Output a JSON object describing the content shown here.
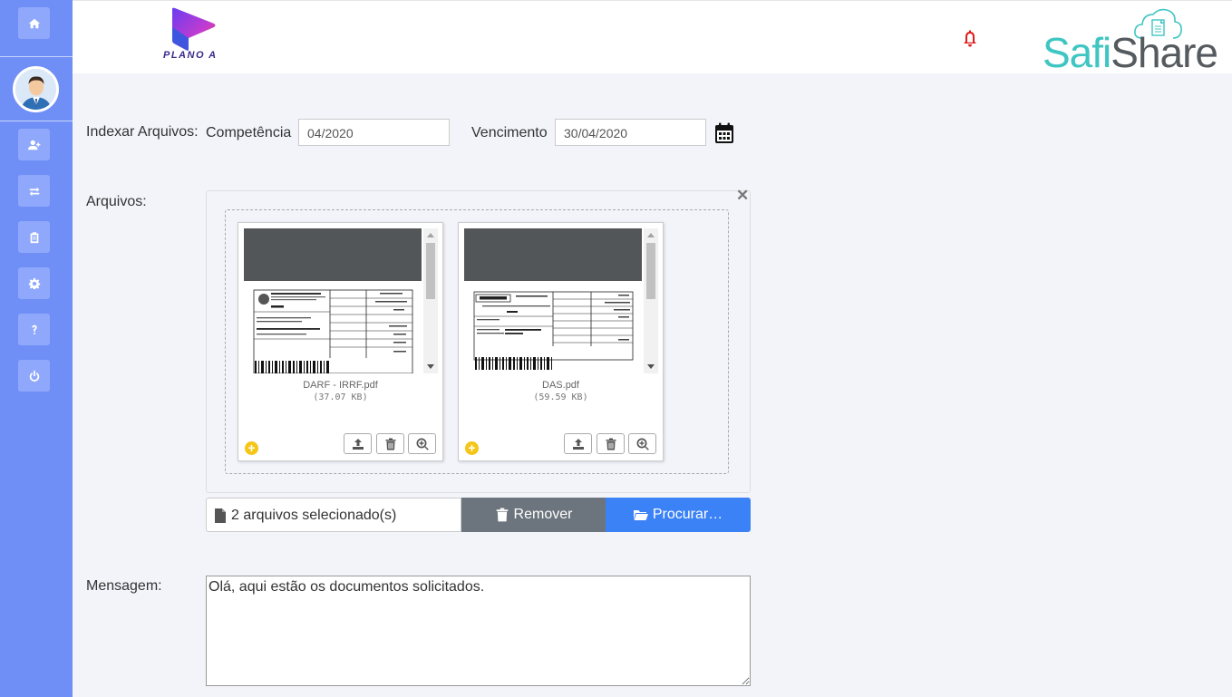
{
  "header": {
    "brand_left": "PLANO A",
    "brand_right_part1": "Safi",
    "brand_right_part2": "Share",
    "notification_icon": "bell-icon",
    "notification_color": "#e01b1b"
  },
  "sidebar": {
    "color": "#6f8ff7",
    "items": [
      {
        "name": "home",
        "icon": "home-icon"
      },
      {
        "name": "add-user",
        "icon": "user-plus-icon"
      },
      {
        "name": "transfer",
        "icon": "exchange-icon"
      },
      {
        "name": "clipboard",
        "icon": "clipboard-icon"
      },
      {
        "name": "settings",
        "icon": "gear-icon"
      },
      {
        "name": "help",
        "icon": "question-icon"
      },
      {
        "name": "logout",
        "icon": "power-icon"
      }
    ]
  },
  "form": {
    "index_label": "Indexar Arquivos:",
    "competencia_label": "Competência",
    "competencia_value": "04/2020",
    "vencimento_label": "Vencimento",
    "vencimento_value": "30/04/2020",
    "files_label": "Arquivos:",
    "message_label": "Mensagem:",
    "message_value": "Olá, aqui estão os documentos solicitados."
  },
  "files": [
    {
      "name": "DARF - IRRF.pdf",
      "size": "(37.07 KB)"
    },
    {
      "name": "DAS.pdf",
      "size": "(59.59 KB)"
    }
  ],
  "file_actions": {
    "selected_text": "2 arquivos selecionado(s)",
    "remove_label": "Remover",
    "browse_label": "Procurar…",
    "remove_color": "#6c757d",
    "browse_color": "#3b82f6"
  }
}
